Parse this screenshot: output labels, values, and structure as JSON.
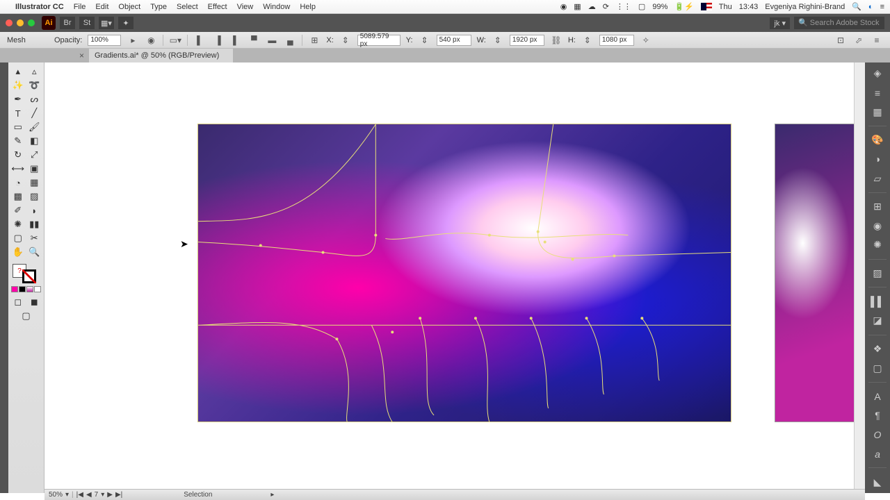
{
  "mac_menu": {
    "apple": "",
    "app": "Illustrator CC",
    "items": [
      "File",
      "Edit",
      "Object",
      "Type",
      "Select",
      "Effect",
      "View",
      "Window",
      "Help"
    ],
    "battery": "99%",
    "day": "Thu",
    "time": "13:43",
    "user": "Evgeniya Righini-Brand"
  },
  "app_bar": {
    "workspace": "jk",
    "search_placeholder": "Search Adobe Stock"
  },
  "control": {
    "label": "Mesh",
    "opacity_label": "Opacity:",
    "opacity": "100%",
    "x_label": "X:",
    "x": "5089.579 px",
    "y_label": "Y:",
    "y": "540 px",
    "w_label": "W:",
    "w": "1920 px",
    "h_label": "H:",
    "h": "1080 px"
  },
  "tab": {
    "title": "Gradients.ai* @ 50% (RGB/Preview)"
  },
  "status": {
    "zoom": "50%",
    "artboard_nav": "7",
    "tool": "Selection"
  },
  "swatches": [
    "#ff00aa",
    "#000000",
    "#c024a0",
    "#ffffff"
  ],
  "cursor": "▲"
}
